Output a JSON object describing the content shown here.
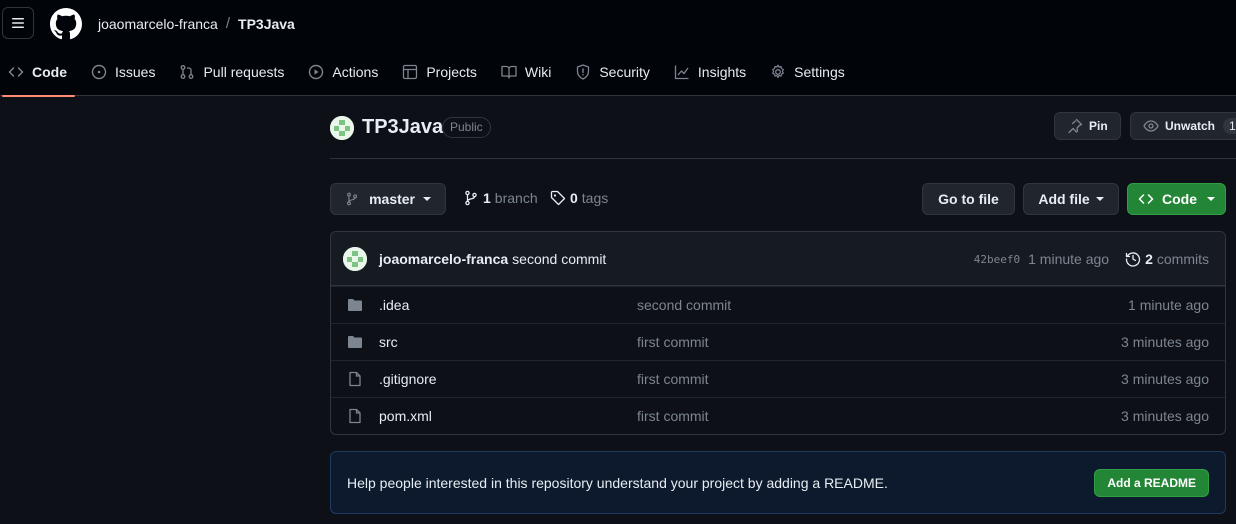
{
  "header": {
    "owner": "joaomarcelo-franca",
    "separator": "/",
    "repo": "TP3Java"
  },
  "nav": {
    "items": [
      {
        "label": "Code",
        "icon": "code-icon"
      },
      {
        "label": "Issues",
        "icon": "issue-icon"
      },
      {
        "label": "Pull requests",
        "icon": "pull-request-icon"
      },
      {
        "label": "Actions",
        "icon": "play-icon"
      },
      {
        "label": "Projects",
        "icon": "table-icon"
      },
      {
        "label": "Wiki",
        "icon": "book-icon"
      },
      {
        "label": "Security",
        "icon": "shield-icon"
      },
      {
        "label": "Insights",
        "icon": "graph-icon"
      },
      {
        "label": "Settings",
        "icon": "gear-icon"
      }
    ]
  },
  "repo": {
    "name": "TP3Java",
    "visibility": "Public",
    "pin_label": "Pin",
    "watch_label": "Unwatch",
    "watch_count": "1"
  },
  "branch_bar": {
    "branch": "master",
    "branch_count": "1",
    "branch_word": "branch",
    "tag_count": "0",
    "tag_word": "tags",
    "go_to_file": "Go to file",
    "add_file": "Add file",
    "code": "Code"
  },
  "latest_commit": {
    "author": "joaomarcelo-franca",
    "message": "second commit",
    "sha": "42beef0",
    "time": "1 minute ago",
    "commit_count": "2",
    "commit_word": "commits"
  },
  "files": [
    {
      "name": ".idea",
      "type": "folder",
      "message": "second commit",
      "time": "1 minute ago"
    },
    {
      "name": "src",
      "type": "folder",
      "message": "first commit",
      "time": "3 minutes ago"
    },
    {
      "name": ".gitignore",
      "type": "file",
      "message": "first commit",
      "time": "3 minutes ago"
    },
    {
      "name": "pom.xml",
      "type": "file",
      "message": "first commit",
      "time": "3 minutes ago"
    }
  ],
  "readme_banner": {
    "text": "Help people interested in this repository understand your project by adding a README.",
    "button": "Add a README"
  },
  "colors": {
    "accent_green": "#238636",
    "nav_underline": "#fd8c73",
    "background": "#0d1117"
  }
}
